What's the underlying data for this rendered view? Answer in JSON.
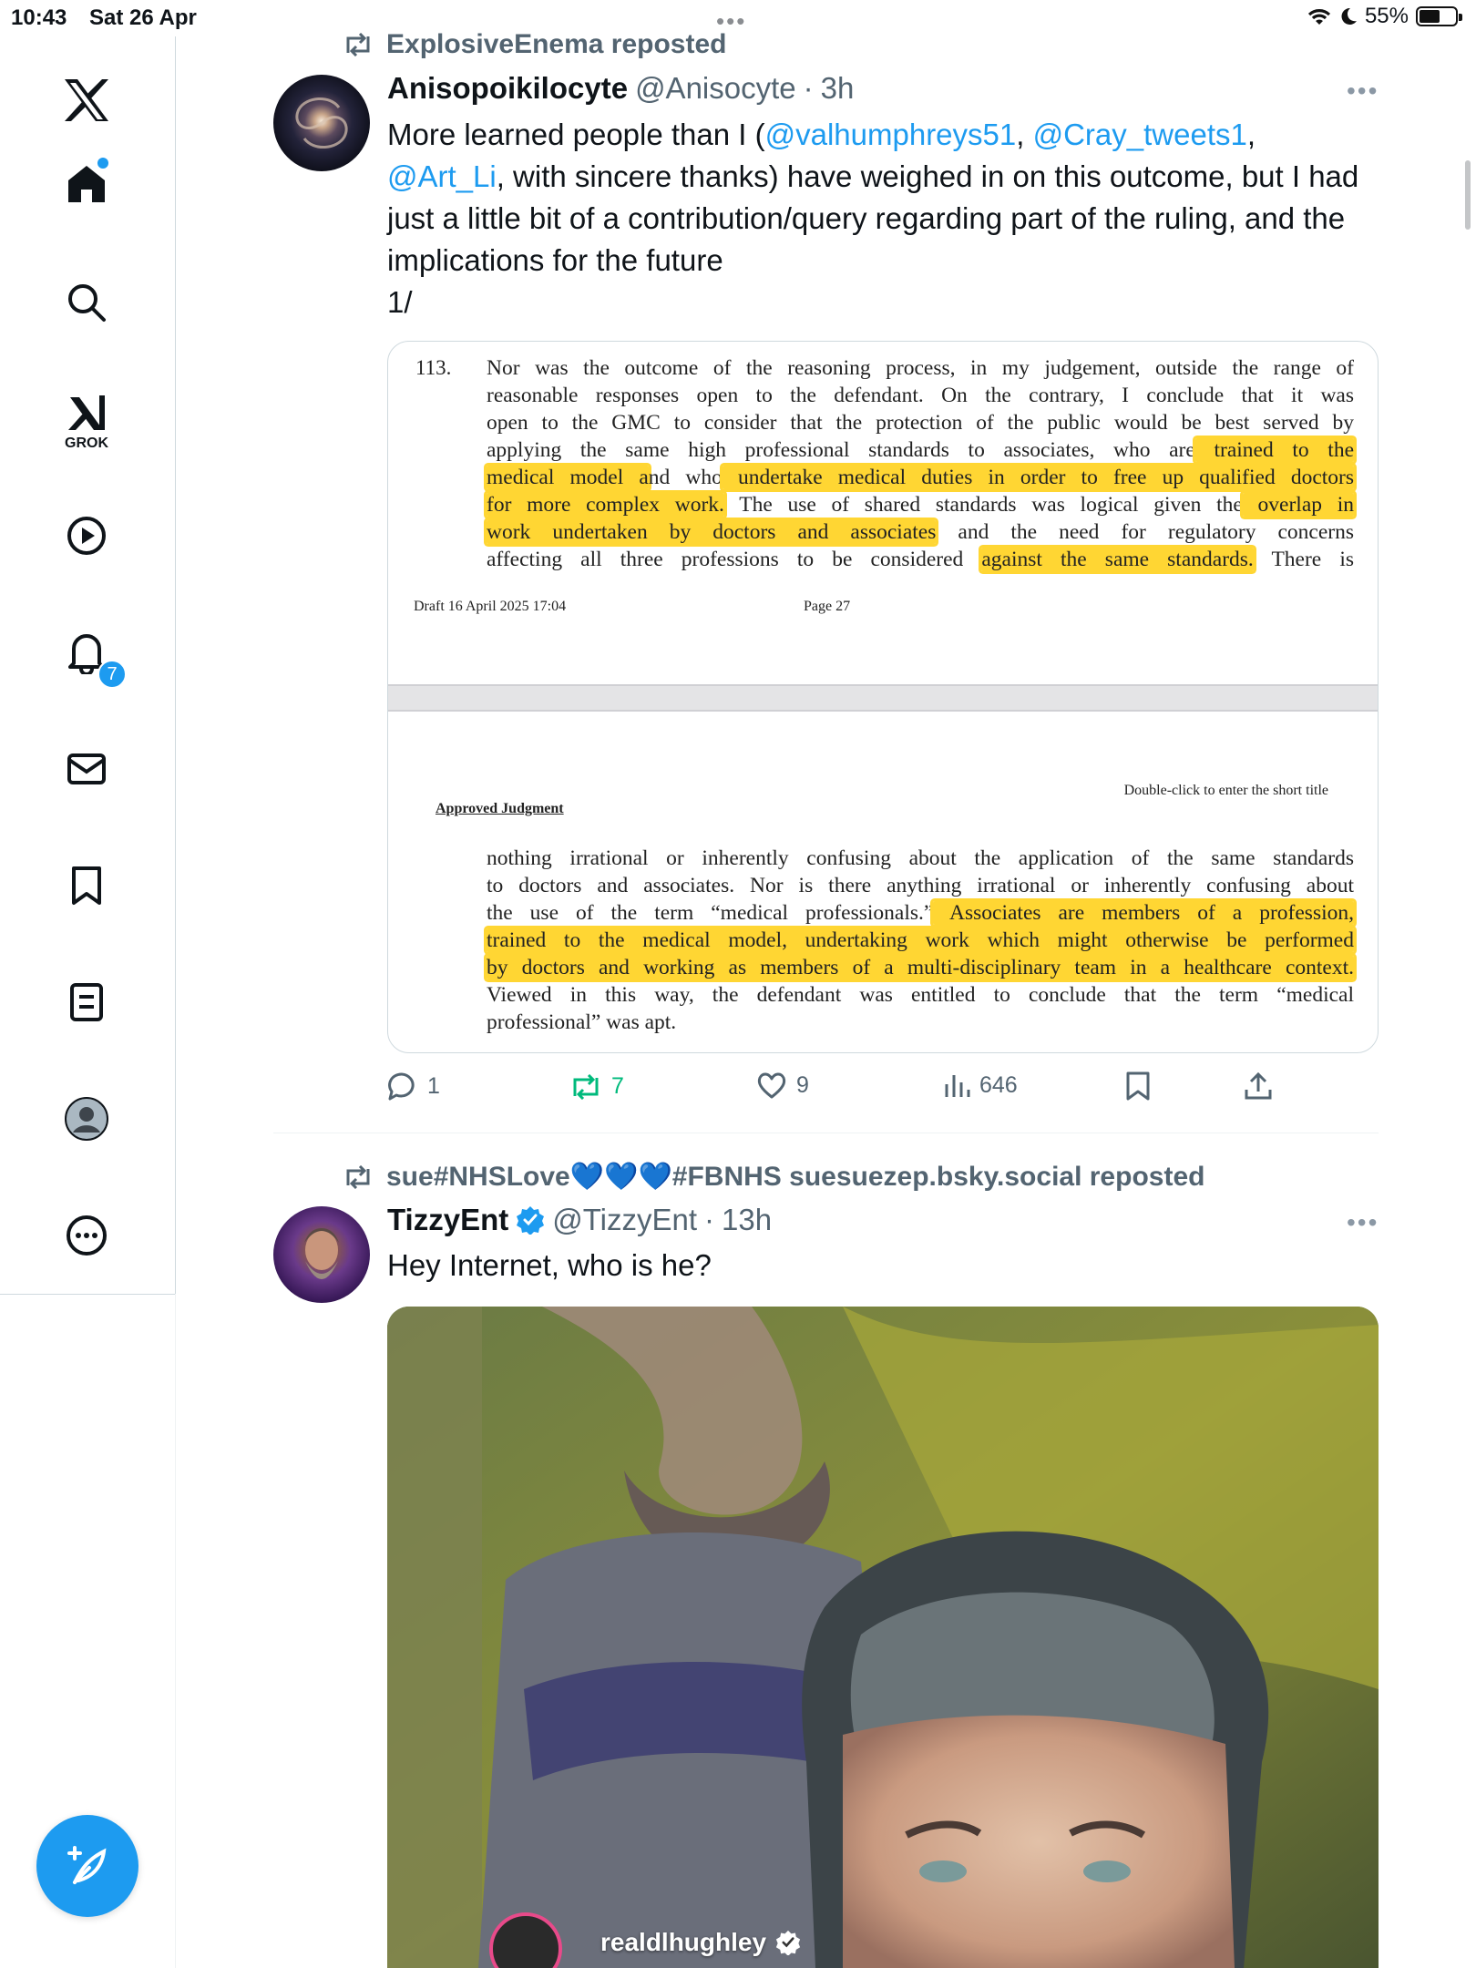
{
  "status_bar": {
    "time": "10:43",
    "date": "Sat 26 Apr",
    "battery": "55%",
    "battery_level": 0.55
  },
  "sidebar": {
    "notifications_badge": "7",
    "grok_label": "GROK"
  },
  "tweet1": {
    "reposted_by": "ExplosiveEnema reposted",
    "display_name": "Anisopoikilocyte",
    "handle": "@Anisocyte",
    "time": "3h",
    "text_parts": {
      "p1": "More learned people than I (",
      "m1": "@valhumphreys51",
      "p2": ", ",
      "m2": "@Cray_tweets1",
      "p3": ",",
      "m3": "@Art_Li",
      "p4": ", with sincere thanks) have weighed in on this outcome, but I had just a little bit of a contribution/query regarding part of the ruling, and the implications for the future",
      "p5": "1/"
    },
    "document": {
      "para_number": "113.",
      "para1": {
        "l1": "Nor was the outcome of the reasoning process, in my judgement, outside the range of",
        "l2": "reasonable responses open to the defendant.  On the contrary, I conclude that it was",
        "l3": "open to the GMC to consider that the protection of the public would be best served by",
        "l4a": "applying the same high professional standards to associates, who are",
        "l4b": " trained to the",
        "l5a": "medical model a",
        "l5b": "nd who",
        "l5c": " undertake medical duties in order to free up qualified doctors",
        "l6a": "for more complex work.",
        "l6b": " The use of shared standards was logical given the",
        "l6c": " overlap in",
        "l7a": "work undertaken by doctors and associates",
        "l7b": " and the need for regulatory concerns",
        "l8a": "affecting all three professions to be considered ",
        "l8b": "against the same standards.",
        "l8c": "  There is"
      },
      "footer_draft": "Draft  16 April 2025 17:04",
      "footer_page": "Page 27",
      "header_right": "Double-click to enter the short title",
      "header_left": "Approved Judgment",
      "para2": {
        "l1": "nothing irrational or inherently confusing about the application of the same standards",
        "l2": "to doctors and associates.  Nor is there anything irrational or inherently confusing about",
        "l3a": "the use of the term “medical professionals.”",
        "l3b": "  Associates are members of a profession,",
        "l4": "trained to the medical model, undertaking work which might otherwise be performed",
        "l5": "by doctors and working as members of a multi-disciplinary team in a healthcare context.",
        "l6": "Viewed in this way, the defendant was entitled to conclude that the term “medical",
        "l7": "professional” was apt."
      }
    },
    "replies": "1",
    "reposts": "7",
    "likes": "9",
    "views": "646"
  },
  "tweet2": {
    "reposted_by": "sue#NHSLove💙💙💙#FBNHS suesuezep.bsky.social reposted",
    "display_name": "TizzyEnt",
    "handle": "@TizzyEnt",
    "time": "13h",
    "text": "Hey Internet, who is he?",
    "video_overlay_user": "realdlhughley"
  },
  "colors": {
    "accent": "#1d9bf0",
    "repost_green": "#00ba7c",
    "highlight": "#ffd633",
    "muted": "#536471"
  }
}
